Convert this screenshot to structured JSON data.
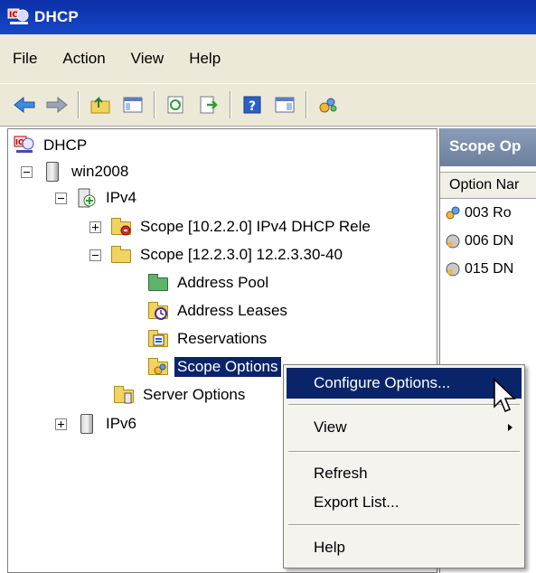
{
  "window": {
    "title": "DHCP"
  },
  "menubar": {
    "items": [
      "File",
      "Action",
      "View",
      "Help"
    ]
  },
  "toolbar": {
    "buttons": [
      "back-icon",
      "forward-icon",
      "up-folder-icon",
      "show-hide-tree-icon",
      "refresh-icon",
      "export-icon",
      "help-icon",
      "properties-icon",
      "dhcp-options-icon"
    ]
  },
  "tree": {
    "root": "DHCP",
    "server": "win2008",
    "ipv4": "IPv4",
    "scope1": "Scope [10.2.2.0] IPv4 DHCP Rele",
    "scope2": "Scope [12.2.3.0] 12.2.3.30-40",
    "address_pool": "Address Pool",
    "address_leases": "Address Leases",
    "reservations": "Reservations",
    "scope_options": "Scope Options",
    "server_options": "Server Options",
    "ipv6": "IPv6"
  },
  "right_panel": {
    "header": "Scope Op",
    "column_header": "Option Nar",
    "rows": [
      "003 Ro",
      "006 DN",
      "015 DN"
    ]
  },
  "context_menu": {
    "items": {
      "configure": "Configure Options...",
      "view": "View",
      "refresh": "Refresh",
      "export": "Export List...",
      "help": "Help"
    }
  },
  "colors": {
    "title_bar": "#0b2fa6",
    "selection": "#0a246a",
    "chrome": "#ece9d8"
  }
}
